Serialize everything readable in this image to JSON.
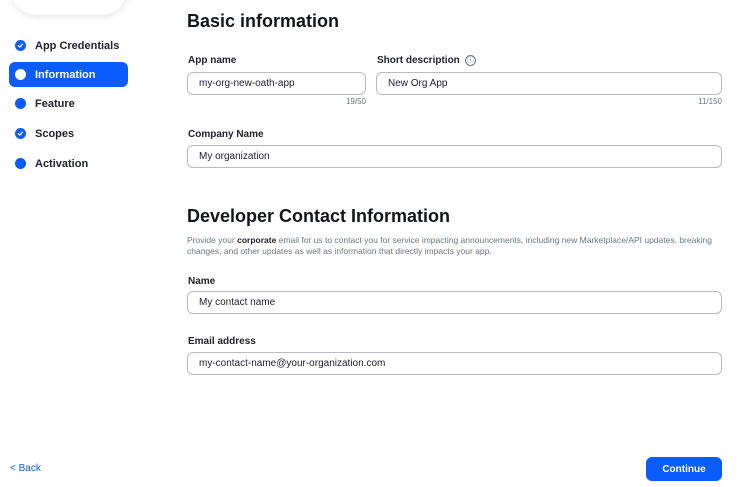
{
  "sidebar": {
    "items": [
      {
        "label": "App Credentials",
        "status": "complete"
      },
      {
        "label": "Information",
        "status": "active"
      },
      {
        "label": "Feature",
        "status": "pending"
      },
      {
        "label": "Scopes",
        "status": "complete"
      },
      {
        "label": "Activation",
        "status": "pending"
      }
    ]
  },
  "basic_info": {
    "title": "Basic information",
    "app_name_label": "App name",
    "app_name_value": "my-org-new-oath-app",
    "app_name_counter": "19/50",
    "short_desc_label": "Short description",
    "short_desc_info_icon": "ⓘ",
    "short_desc_value": "New Org App",
    "short_desc_counter": "11/150",
    "company_label": "Company Name",
    "company_value": "My organization"
  },
  "developer_contact": {
    "title": "Developer Contact Information",
    "desc_prefix": "Provide your ",
    "desc_bold": "corporate",
    "desc_suffix": " email for us to contact you for service impacting announcements, including new Marketplace/API updates, breaking changes, and other updates as well as information that directly impacts your app.",
    "name_label": "Name",
    "name_value": "My contact name",
    "email_label": "Email address",
    "email_value": "my-contact-name@your-organization.com"
  },
  "footer": {
    "back_label": "< Back",
    "continue_label": "Continue"
  },
  "colors": {
    "accent": "#0b5cff",
    "text": "#222230",
    "muted": "#6e7680",
    "border": "#babac4"
  }
}
